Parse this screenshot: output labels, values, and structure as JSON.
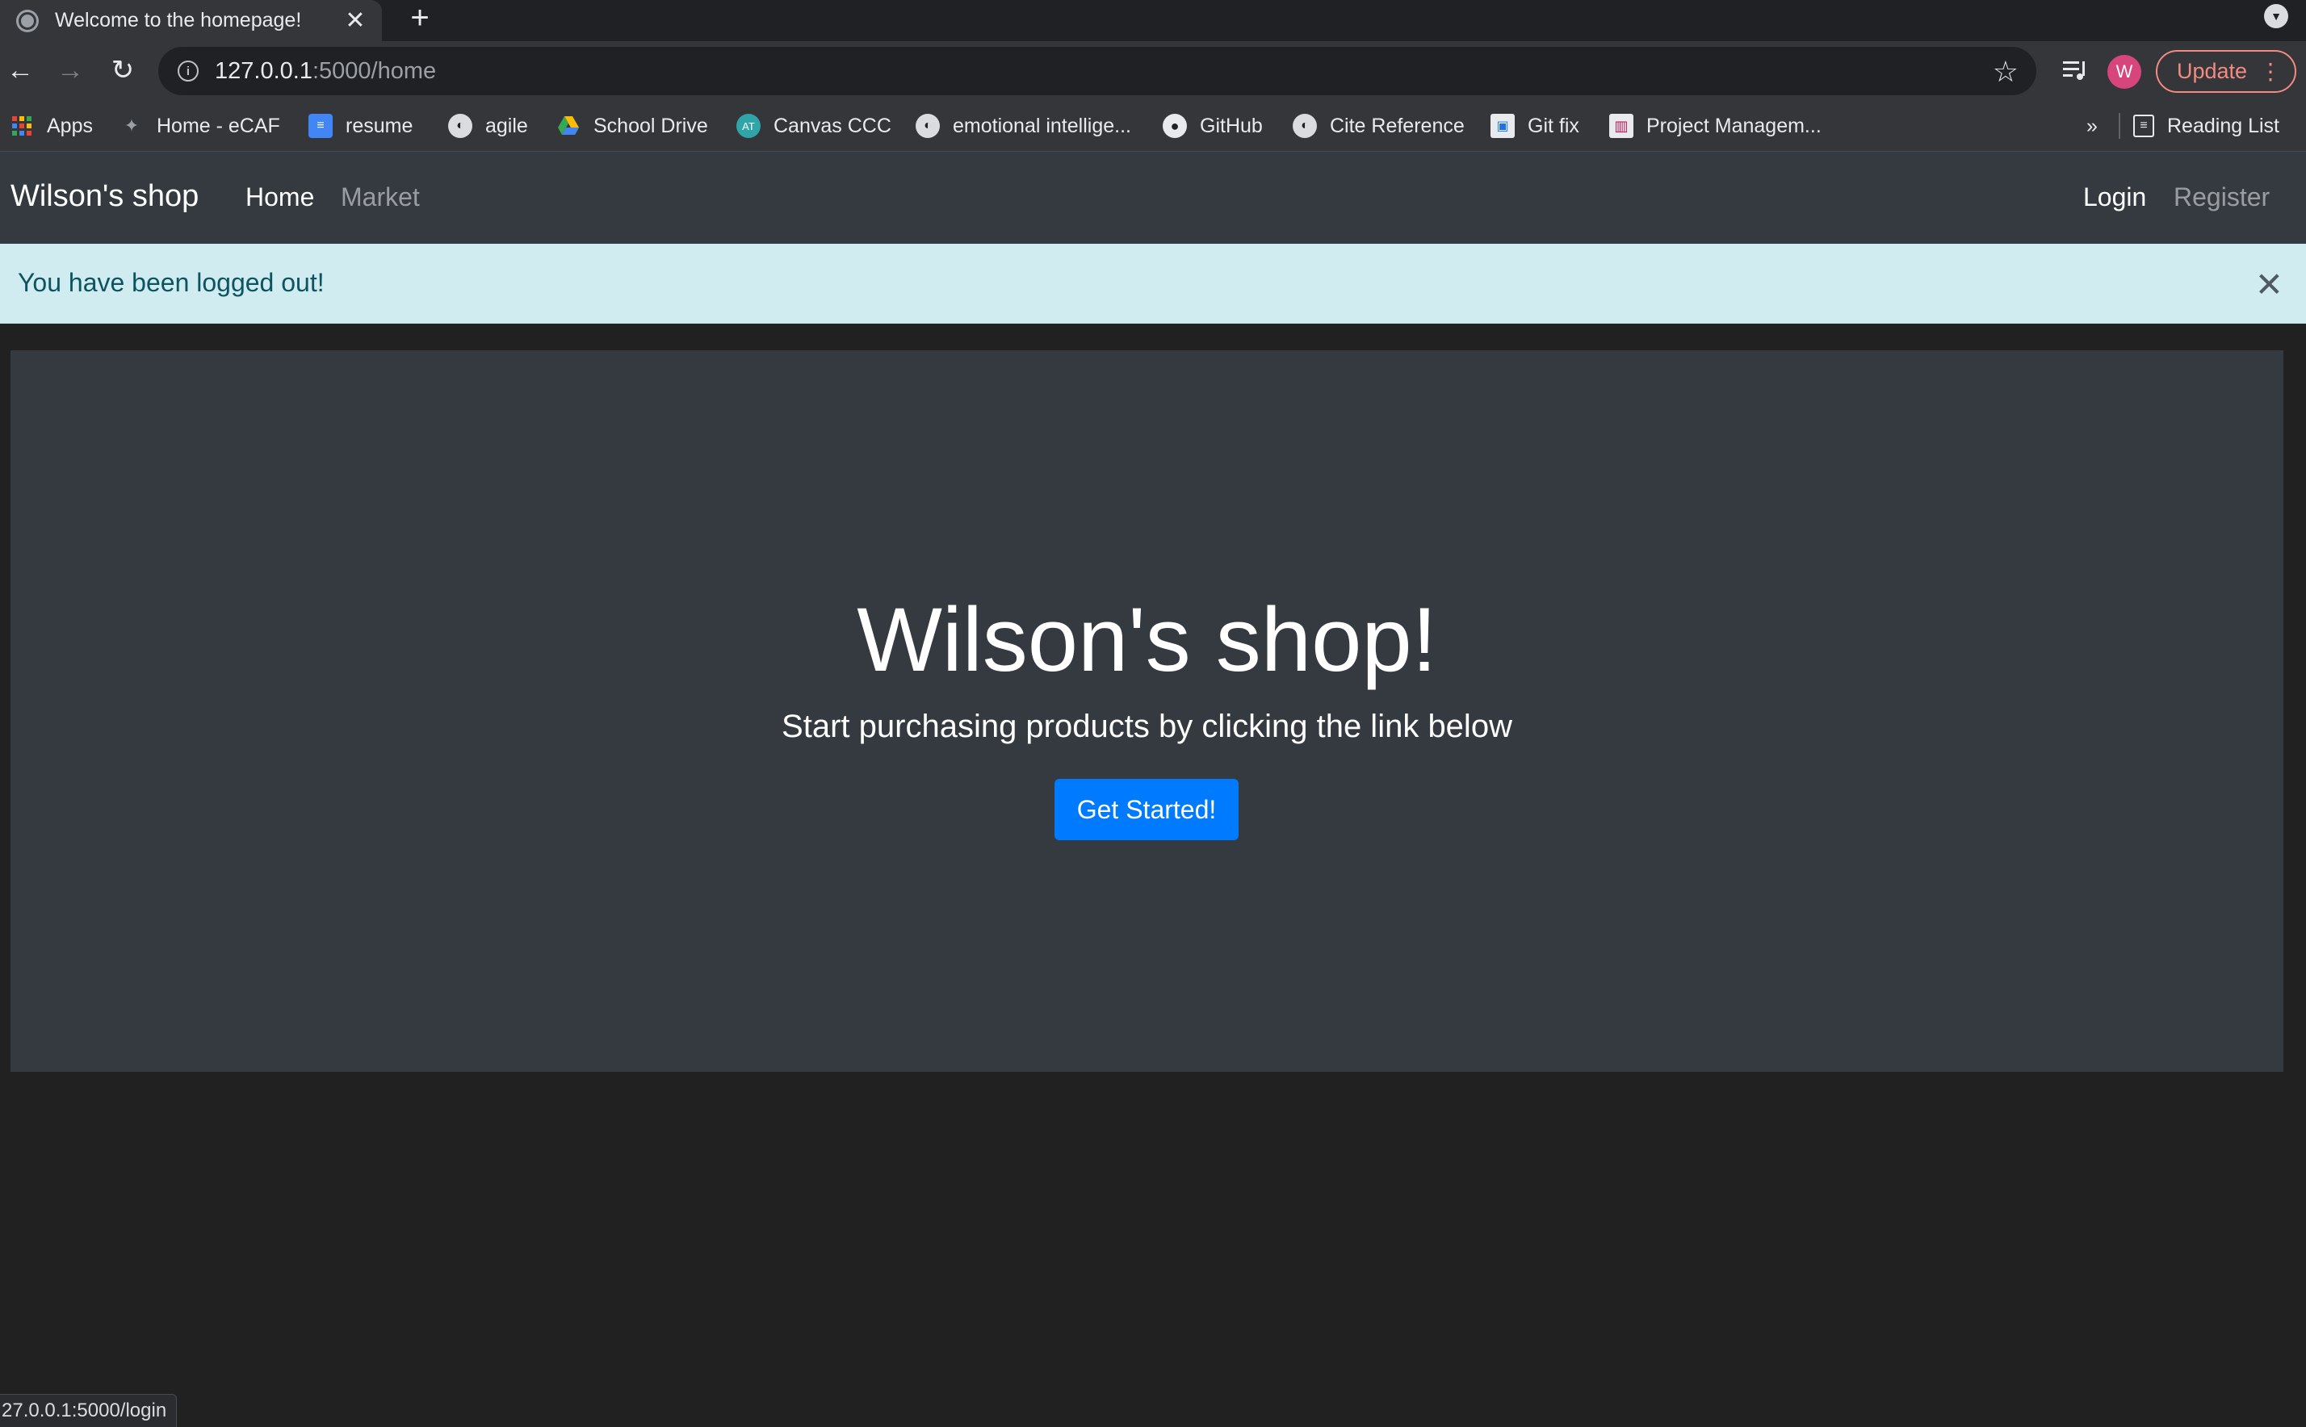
{
  "browser": {
    "tab_title": "Welcome to the homepage!",
    "tab_close": "✕",
    "new_tab": "+",
    "url_host": "127.0.0.1",
    "url_path": ":5000/home",
    "profile_initial": "W",
    "update_label": "Update",
    "bookmarks": [
      {
        "label": "Apps",
        "icon": "apps-grid-icon"
      },
      {
        "label": "Home - eCAF",
        "icon": "ecaf-icon"
      },
      {
        "label": "resume",
        "icon": "docs-icon"
      },
      {
        "label": "agile",
        "icon": "globe-icon"
      },
      {
        "label": "School Drive",
        "icon": "drive-icon"
      },
      {
        "label": "Canvas CCC",
        "icon": "canvas-icon"
      },
      {
        "label": "emotional intellige...",
        "icon": "globe-icon"
      },
      {
        "label": "GitHub",
        "icon": "github-icon"
      },
      {
        "label": "Cite Reference",
        "icon": "globe-icon"
      },
      {
        "label": "Git fix",
        "icon": "gitfix-icon"
      },
      {
        "label": "Project Managem...",
        "icon": "trello-icon"
      }
    ],
    "bookmarks_overflow": "»",
    "reading_list": "Reading List",
    "status_url": "27.0.0.1:5000/login"
  },
  "navbar": {
    "brand": "Wilson's shop",
    "links": {
      "home": "Home",
      "market": "Market",
      "login": "Login",
      "register": "Register"
    }
  },
  "alert": {
    "message": "You have been logged out!",
    "close": "✕"
  },
  "jumbotron": {
    "title": "Wilson's shop!",
    "lead": "Start purchasing products by clicking the link below",
    "button": "Get Started!"
  },
  "colors": {
    "primary_button": "#007bff",
    "alert_bg": "#d1ecf1",
    "alert_text": "#0c5460",
    "navbar_bg": "#343a40",
    "page_bg": "#212121",
    "update_accent": "#f28b82",
    "avatar": "#d6457b"
  }
}
